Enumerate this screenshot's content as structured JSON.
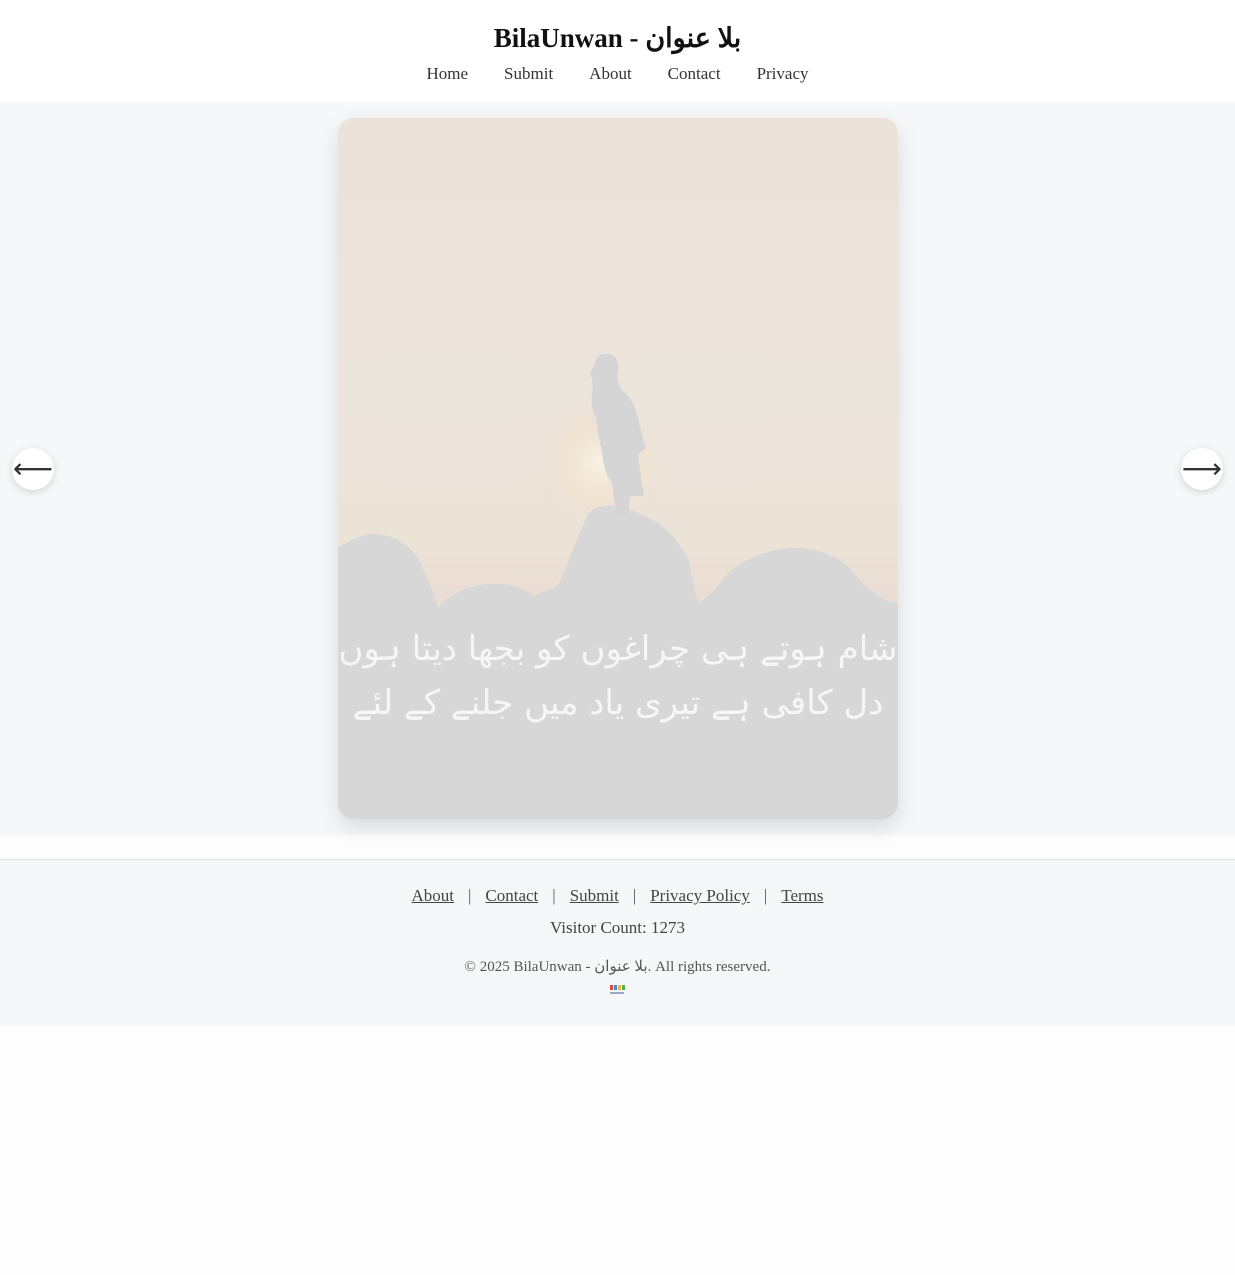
{
  "header": {
    "site_title": "BilaUnwan - بلا عنوان",
    "nav": [
      "Home",
      "Submit",
      "About",
      "Contact",
      "Privacy"
    ]
  },
  "slider": {
    "prev_arrow": "⟵",
    "next_arrow": "⟶",
    "poem_line_1": "شام ہوتے ہی چراغوں کو بجھا دیتا ہوں",
    "poem_line_2": "دل کافی ہے تیری یاد میں جلنے کے لئے"
  },
  "footer": {
    "links": [
      "About",
      "Contact",
      "Submit",
      "Privacy Policy",
      "Terms"
    ],
    "separator": "|",
    "visitor_count": "Visitor Count: 1273",
    "copyright": "© 2025 BilaUnwan - بلا عنوان. All rights reserved."
  }
}
